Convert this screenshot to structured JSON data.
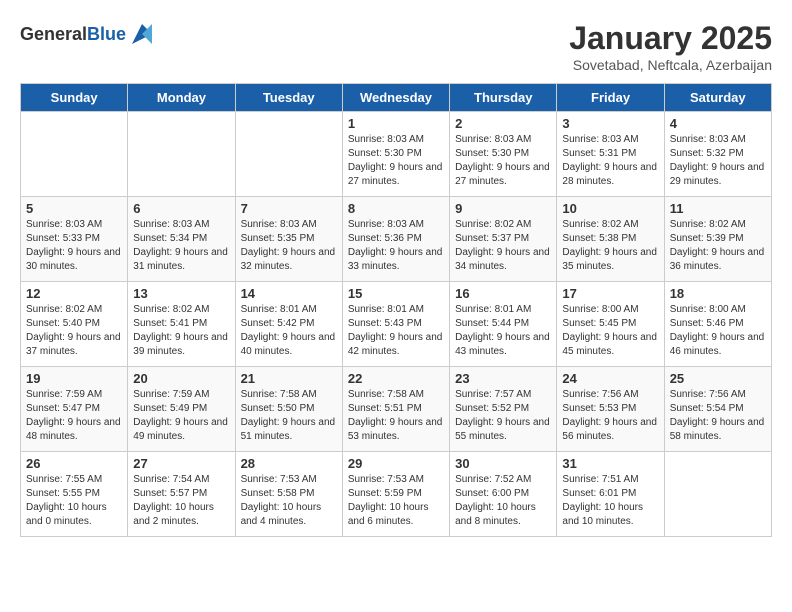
{
  "header": {
    "logo_general": "General",
    "logo_blue": "Blue",
    "title": "January 2025",
    "subtitle": "Sovetabad, Neftcala, Azerbaijan"
  },
  "days_of_week": [
    "Sunday",
    "Monday",
    "Tuesday",
    "Wednesday",
    "Thursday",
    "Friday",
    "Saturday"
  ],
  "weeks": [
    [
      {
        "day": "",
        "text": ""
      },
      {
        "day": "",
        "text": ""
      },
      {
        "day": "",
        "text": ""
      },
      {
        "day": "1",
        "text": "Sunrise: 8:03 AM\nSunset: 5:30 PM\nDaylight: 9 hours and 27 minutes."
      },
      {
        "day": "2",
        "text": "Sunrise: 8:03 AM\nSunset: 5:30 PM\nDaylight: 9 hours and 27 minutes."
      },
      {
        "day": "3",
        "text": "Sunrise: 8:03 AM\nSunset: 5:31 PM\nDaylight: 9 hours and 28 minutes."
      },
      {
        "day": "4",
        "text": "Sunrise: 8:03 AM\nSunset: 5:32 PM\nDaylight: 9 hours and 29 minutes."
      }
    ],
    [
      {
        "day": "5",
        "text": "Sunrise: 8:03 AM\nSunset: 5:33 PM\nDaylight: 9 hours and 30 minutes."
      },
      {
        "day": "6",
        "text": "Sunrise: 8:03 AM\nSunset: 5:34 PM\nDaylight: 9 hours and 31 minutes."
      },
      {
        "day": "7",
        "text": "Sunrise: 8:03 AM\nSunset: 5:35 PM\nDaylight: 9 hours and 32 minutes."
      },
      {
        "day": "8",
        "text": "Sunrise: 8:03 AM\nSunset: 5:36 PM\nDaylight: 9 hours and 33 minutes."
      },
      {
        "day": "9",
        "text": "Sunrise: 8:02 AM\nSunset: 5:37 PM\nDaylight: 9 hours and 34 minutes."
      },
      {
        "day": "10",
        "text": "Sunrise: 8:02 AM\nSunset: 5:38 PM\nDaylight: 9 hours and 35 minutes."
      },
      {
        "day": "11",
        "text": "Sunrise: 8:02 AM\nSunset: 5:39 PM\nDaylight: 9 hours and 36 minutes."
      }
    ],
    [
      {
        "day": "12",
        "text": "Sunrise: 8:02 AM\nSunset: 5:40 PM\nDaylight: 9 hours and 37 minutes."
      },
      {
        "day": "13",
        "text": "Sunrise: 8:02 AM\nSunset: 5:41 PM\nDaylight: 9 hours and 39 minutes."
      },
      {
        "day": "14",
        "text": "Sunrise: 8:01 AM\nSunset: 5:42 PM\nDaylight: 9 hours and 40 minutes."
      },
      {
        "day": "15",
        "text": "Sunrise: 8:01 AM\nSunset: 5:43 PM\nDaylight: 9 hours and 42 minutes."
      },
      {
        "day": "16",
        "text": "Sunrise: 8:01 AM\nSunset: 5:44 PM\nDaylight: 9 hours and 43 minutes."
      },
      {
        "day": "17",
        "text": "Sunrise: 8:00 AM\nSunset: 5:45 PM\nDaylight: 9 hours and 45 minutes."
      },
      {
        "day": "18",
        "text": "Sunrise: 8:00 AM\nSunset: 5:46 PM\nDaylight: 9 hours and 46 minutes."
      }
    ],
    [
      {
        "day": "19",
        "text": "Sunrise: 7:59 AM\nSunset: 5:47 PM\nDaylight: 9 hours and 48 minutes."
      },
      {
        "day": "20",
        "text": "Sunrise: 7:59 AM\nSunset: 5:49 PM\nDaylight: 9 hours and 49 minutes."
      },
      {
        "day": "21",
        "text": "Sunrise: 7:58 AM\nSunset: 5:50 PM\nDaylight: 9 hours and 51 minutes."
      },
      {
        "day": "22",
        "text": "Sunrise: 7:58 AM\nSunset: 5:51 PM\nDaylight: 9 hours and 53 minutes."
      },
      {
        "day": "23",
        "text": "Sunrise: 7:57 AM\nSunset: 5:52 PM\nDaylight: 9 hours and 55 minutes."
      },
      {
        "day": "24",
        "text": "Sunrise: 7:56 AM\nSunset: 5:53 PM\nDaylight: 9 hours and 56 minutes."
      },
      {
        "day": "25",
        "text": "Sunrise: 7:56 AM\nSunset: 5:54 PM\nDaylight: 9 hours and 58 minutes."
      }
    ],
    [
      {
        "day": "26",
        "text": "Sunrise: 7:55 AM\nSunset: 5:55 PM\nDaylight: 10 hours and 0 minutes."
      },
      {
        "day": "27",
        "text": "Sunrise: 7:54 AM\nSunset: 5:57 PM\nDaylight: 10 hours and 2 minutes."
      },
      {
        "day": "28",
        "text": "Sunrise: 7:53 AM\nSunset: 5:58 PM\nDaylight: 10 hours and 4 minutes."
      },
      {
        "day": "29",
        "text": "Sunrise: 7:53 AM\nSunset: 5:59 PM\nDaylight: 10 hours and 6 minutes."
      },
      {
        "day": "30",
        "text": "Sunrise: 7:52 AM\nSunset: 6:00 PM\nDaylight: 10 hours and 8 minutes."
      },
      {
        "day": "31",
        "text": "Sunrise: 7:51 AM\nSunset: 6:01 PM\nDaylight: 10 hours and 10 minutes."
      },
      {
        "day": "",
        "text": ""
      }
    ]
  ]
}
